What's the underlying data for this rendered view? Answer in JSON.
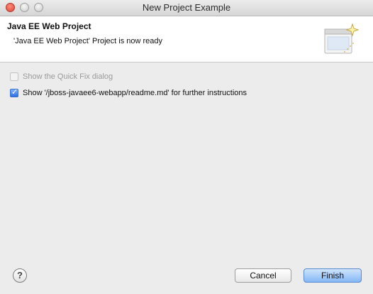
{
  "window": {
    "title": "New Project Example"
  },
  "header": {
    "title": "Java EE Web Project",
    "message": "'Java EE Web Project' Project is now ready"
  },
  "options": [
    {
      "label": "Show the Quick Fix dialog",
      "checked": false,
      "enabled": false
    },
    {
      "label": "Show '/jboss-javaee6-webapp/readme.md' for further instructions",
      "checked": true,
      "enabled": true
    }
  ],
  "footer": {
    "help_icon": "question-mark-icon",
    "help_symbol": "?",
    "cancel_label": "Cancel",
    "finish_label": "Finish"
  },
  "colors": {
    "accent": "#84b7f4",
    "checkbox_checked": "#2a6fe0",
    "disabled_text": "#9b9b9b"
  }
}
